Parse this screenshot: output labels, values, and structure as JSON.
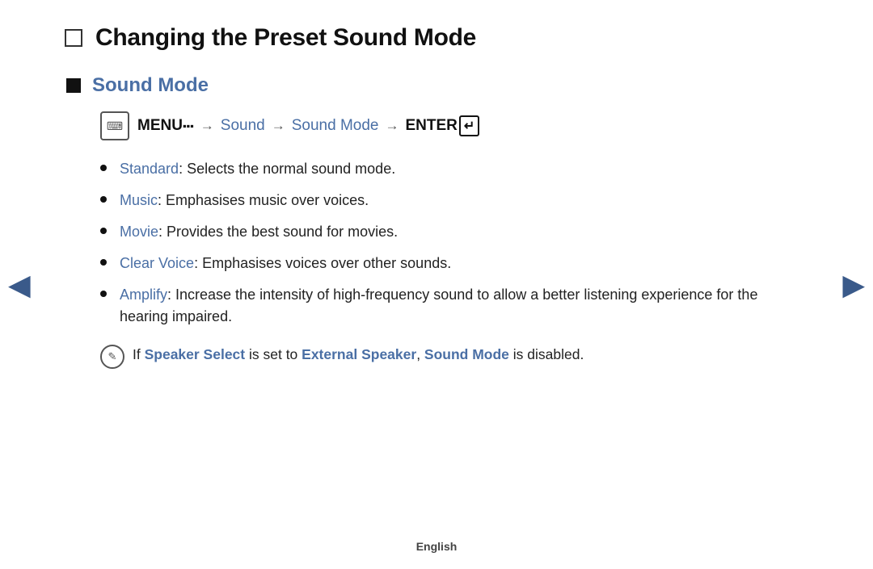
{
  "page": {
    "heading": "Changing the Preset Sound Mode",
    "section_title": "Sound Mode",
    "menu_path": {
      "icon_symbol": "⌨",
      "menu_label": "MENU",
      "menu_extra": "III",
      "arrow": "→",
      "sound": "Sound",
      "sound_mode": "Sound Mode",
      "enter_label": "ENTER"
    },
    "bullet_items": [
      {
        "term": "Standard",
        "desc": ": Selects the normal sound mode."
      },
      {
        "term": "Music",
        "desc": ": Emphasises music over voices."
      },
      {
        "term": "Movie",
        "desc": ": Provides the best sound for movies."
      },
      {
        "term": "Clear Voice",
        "desc": ": Emphasises voices over other sounds."
      },
      {
        "term": "Amplify",
        "desc": ": Increase the intensity of high-frequency sound to allow a better listening experience for the hearing impaired."
      }
    ],
    "note": {
      "prefix": " If ",
      "speaker_select": "Speaker Select",
      "middle1": " is set to ",
      "external_speaker": "External Speaker",
      "separator": ", ",
      "sound_mode": "Sound Mode",
      "suffix": " is disabled."
    },
    "nav_left": "◀",
    "nav_right": "▶",
    "footer": "English"
  }
}
